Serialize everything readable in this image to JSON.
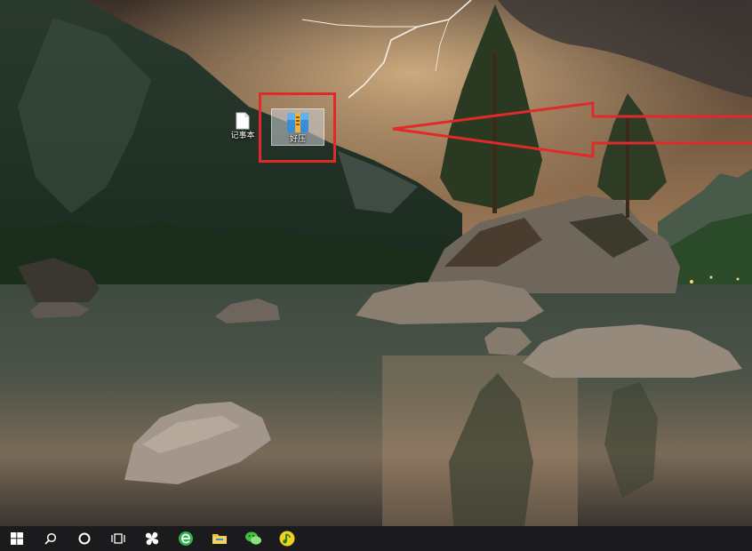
{
  "desktop": {
    "wallpaper": "lake-mountain-lightning",
    "icons": [
      {
        "name": "notepad",
        "label": "记事本",
        "icon": "text-file-icon"
      },
      {
        "name": "winrar-archive",
        "label": "好压",
        "icon": "archive-icon",
        "selected": true
      }
    ]
  },
  "annotation": {
    "box_color": "#e02a2a",
    "arrow_color": "#e02a2a",
    "arrow_direction": "left"
  },
  "taskbar": {
    "background": "#1b1b1d",
    "buttons": [
      {
        "name": "start-button",
        "icon": "windows-logo-icon"
      },
      {
        "name": "search-button",
        "icon": "search-icon"
      },
      {
        "name": "cortana-button",
        "icon": "cortana-circle-icon"
      },
      {
        "name": "task-view-button",
        "icon": "task-view-icon"
      },
      {
        "name": "app-pinwheel",
        "icon": "pinwheel-icon"
      },
      {
        "name": "app-browser",
        "icon": "browser-e-icon"
      },
      {
        "name": "app-file-explorer",
        "icon": "folder-icon"
      },
      {
        "name": "app-wechat",
        "icon": "wechat-icon"
      },
      {
        "name": "app-media-player",
        "icon": "music-note-icon"
      }
    ]
  }
}
